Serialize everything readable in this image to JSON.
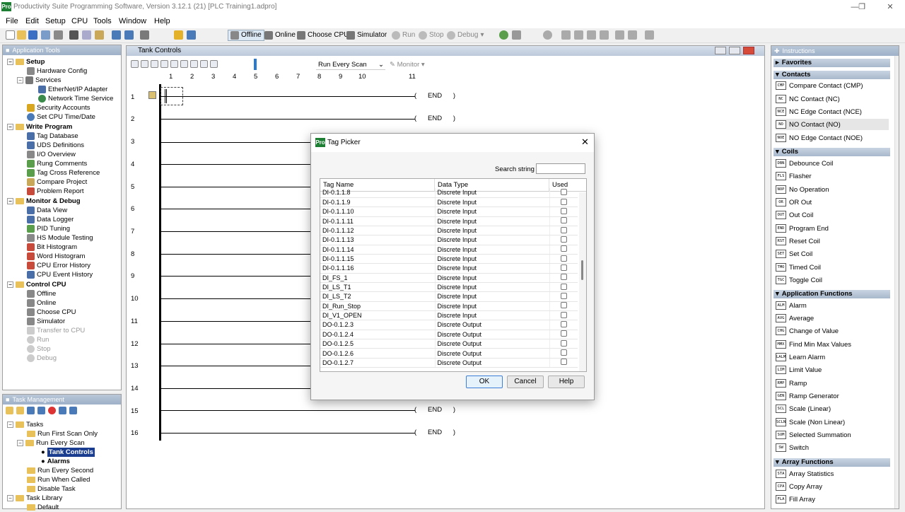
{
  "app": {
    "title": "Productivity Suite Programming Software, Version 3.12.1 (21)   [PLC Training1.adpro]",
    "logo": "Pro"
  },
  "menu": [
    "File",
    "Edit",
    "Setup",
    "CPU",
    "Tools",
    "Window",
    "Help"
  ],
  "toolbar": {
    "offline": "Offline",
    "online": "Online",
    "choose_cpu": "Choose CPU",
    "simulator": "Simulator",
    "run": "Run",
    "stop": "Stop",
    "debug": "Debug"
  },
  "app_tools": {
    "header": "Application Tools",
    "setup": {
      "label": "Setup",
      "items": [
        "Hardware Config",
        "Services",
        "EtherNet/IP Adapter",
        "Network Time Service",
        "Security Accounts",
        "Set CPU Time/Date"
      ]
    },
    "write_program": {
      "label": "Write Program",
      "items": [
        "Tag Database",
        "UDS Definitions",
        "I/O Overview",
        "Rung Comments",
        "Tag Cross Reference",
        "Compare Project",
        "Problem Report"
      ]
    },
    "monitor_debug": {
      "label": "Monitor & Debug",
      "items": [
        "Data View",
        "Data Logger",
        "PID Tuning",
        "HS Module Testing",
        "Bit Histogram",
        "Word Histogram",
        "CPU Error History",
        "CPU Event History"
      ]
    },
    "control_cpu": {
      "label": "Control CPU",
      "items": [
        "Offline",
        "Online",
        "Choose CPU",
        "Simulator",
        "Transfer to CPU",
        "Run",
        "Stop",
        "Debug"
      ]
    }
  },
  "task_mgmt": {
    "header": "Task Management",
    "items": [
      "Tasks",
      "Run First Scan Only",
      "Run Every Scan",
      "Tank Controls",
      "Alarms",
      "Run Every Second",
      "Run When Called",
      "Disable Task",
      "Task Library",
      "Default"
    ]
  },
  "editor": {
    "title": "Tank Controls",
    "scan_select": "Run Every Scan",
    "monitor": "Monitor",
    "columns": [
      "1",
      "2",
      "3",
      "4",
      "5",
      "6",
      "7",
      "8",
      "9",
      "10",
      "11"
    ],
    "rungs": [
      "1",
      "2",
      "3",
      "4",
      "5",
      "6",
      "7",
      "8",
      "9",
      "10",
      "11",
      "12",
      "13",
      "14",
      "15",
      "16"
    ],
    "end_label": "END"
  },
  "dialog": {
    "title": "Tag Picker",
    "search_label": "Search string",
    "search_value": "",
    "columns": [
      "Tag Name",
      "Data Type",
      "Used"
    ],
    "rows": [
      [
        "DI-0.1.1.8",
        "Discrete Input"
      ],
      [
        "DI-0.1.1.9",
        "Discrete Input"
      ],
      [
        "DI-0.1.1.10",
        "Discrete Input"
      ],
      [
        "DI-0.1.1.11",
        "Discrete Input"
      ],
      [
        "DI-0.1.1.12",
        "Discrete Input"
      ],
      [
        "DI-0.1.1.13",
        "Discrete Input"
      ],
      [
        "DI-0.1.1.14",
        "Discrete Input"
      ],
      [
        "DI-0.1.1.15",
        "Discrete Input"
      ],
      [
        "DI-0.1.1.16",
        "Discrete Input"
      ],
      [
        "DI_FS_1",
        "Discrete Input"
      ],
      [
        "DI_LS_T1",
        "Discrete Input"
      ],
      [
        "DI_LS_T2",
        "Discrete Input"
      ],
      [
        "DI_Run_Stop",
        "Discrete Input"
      ],
      [
        "DI_V1_OPEN",
        "Discrete Input"
      ],
      [
        "DO-0.1.2.3",
        "Discrete Output"
      ],
      [
        "DO-0.1.2.4",
        "Discrete Output"
      ],
      [
        "DO-0.1.2.5",
        "Discrete Output"
      ],
      [
        "DO-0.1.2.6",
        "Discrete Output"
      ],
      [
        "DO-0.1.2.7",
        "Discrete Output"
      ]
    ],
    "ok": "OK",
    "cancel": "Cancel",
    "help": "Help"
  },
  "instructions": {
    "header": "Instructions",
    "favorites": "Favorites",
    "contacts": {
      "label": "Contacts",
      "items": [
        {
          "abbr": "CMP",
          "label": "Compare Contact (CMP)"
        },
        {
          "abbr": "NC",
          "label": "NC Contact (NC)"
        },
        {
          "abbr": "NCE",
          "label": "NC Edge Contact (NCE)"
        },
        {
          "abbr": "NO",
          "label": "NO Contact (NO)"
        },
        {
          "abbr": "NOE",
          "label": "NO Edge Contact (NOE)"
        }
      ]
    },
    "coils": {
      "label": "Coils",
      "items": [
        {
          "abbr": "DBN",
          "label": "Debounce Coil"
        },
        {
          "abbr": "FLS",
          "label": "Flasher"
        },
        {
          "abbr": "NOP",
          "label": "No Operation"
        },
        {
          "abbr": "OR",
          "label": "OR Out"
        },
        {
          "abbr": "OUT",
          "label": "Out Coil"
        },
        {
          "abbr": "END",
          "label": "Program End"
        },
        {
          "abbr": "RST",
          "label": "Reset Coil"
        },
        {
          "abbr": "SET",
          "label": "Set Coil"
        },
        {
          "abbr": "TMO",
          "label": "Timed Coil"
        },
        {
          "abbr": "TGC",
          "label": "Toggle Coil"
        }
      ]
    },
    "app_functions": {
      "label": "Application Functions",
      "items": [
        {
          "abbr": "ALM",
          "label": "Alarm"
        },
        {
          "abbr": "AVG",
          "label": "Average"
        },
        {
          "abbr": "CHG",
          "label": "Change of Value"
        },
        {
          "abbr": "MMX",
          "label": "Find Min Max Values"
        },
        {
          "abbr": "LALM",
          "label": "Learn Alarm"
        },
        {
          "abbr": "LIM",
          "label": "Limit Value"
        },
        {
          "abbr": "RMP",
          "label": "Ramp"
        },
        {
          "abbr": "GEN",
          "label": "Ramp Generator"
        },
        {
          "abbr": "SCL",
          "label": "Scale (Linear)"
        },
        {
          "abbr": "SCLN",
          "label": "Scale (Non Linear)"
        },
        {
          "abbr": "SUM",
          "label": "Selected Summation"
        },
        {
          "abbr": "SW",
          "label": "Switch"
        }
      ]
    },
    "array_functions": {
      "label": "Array Functions",
      "items": [
        {
          "abbr": "STA",
          "label": "Array Statistics"
        },
        {
          "abbr": "CPA",
          "label": "Copy Array"
        },
        {
          "abbr": "FLA",
          "label": "Fill Array"
        }
      ]
    }
  },
  "colors": {
    "accent": "#1a3d8f",
    "panel_header": "#9eb1c8",
    "ok_border": "#3c7fd9"
  }
}
